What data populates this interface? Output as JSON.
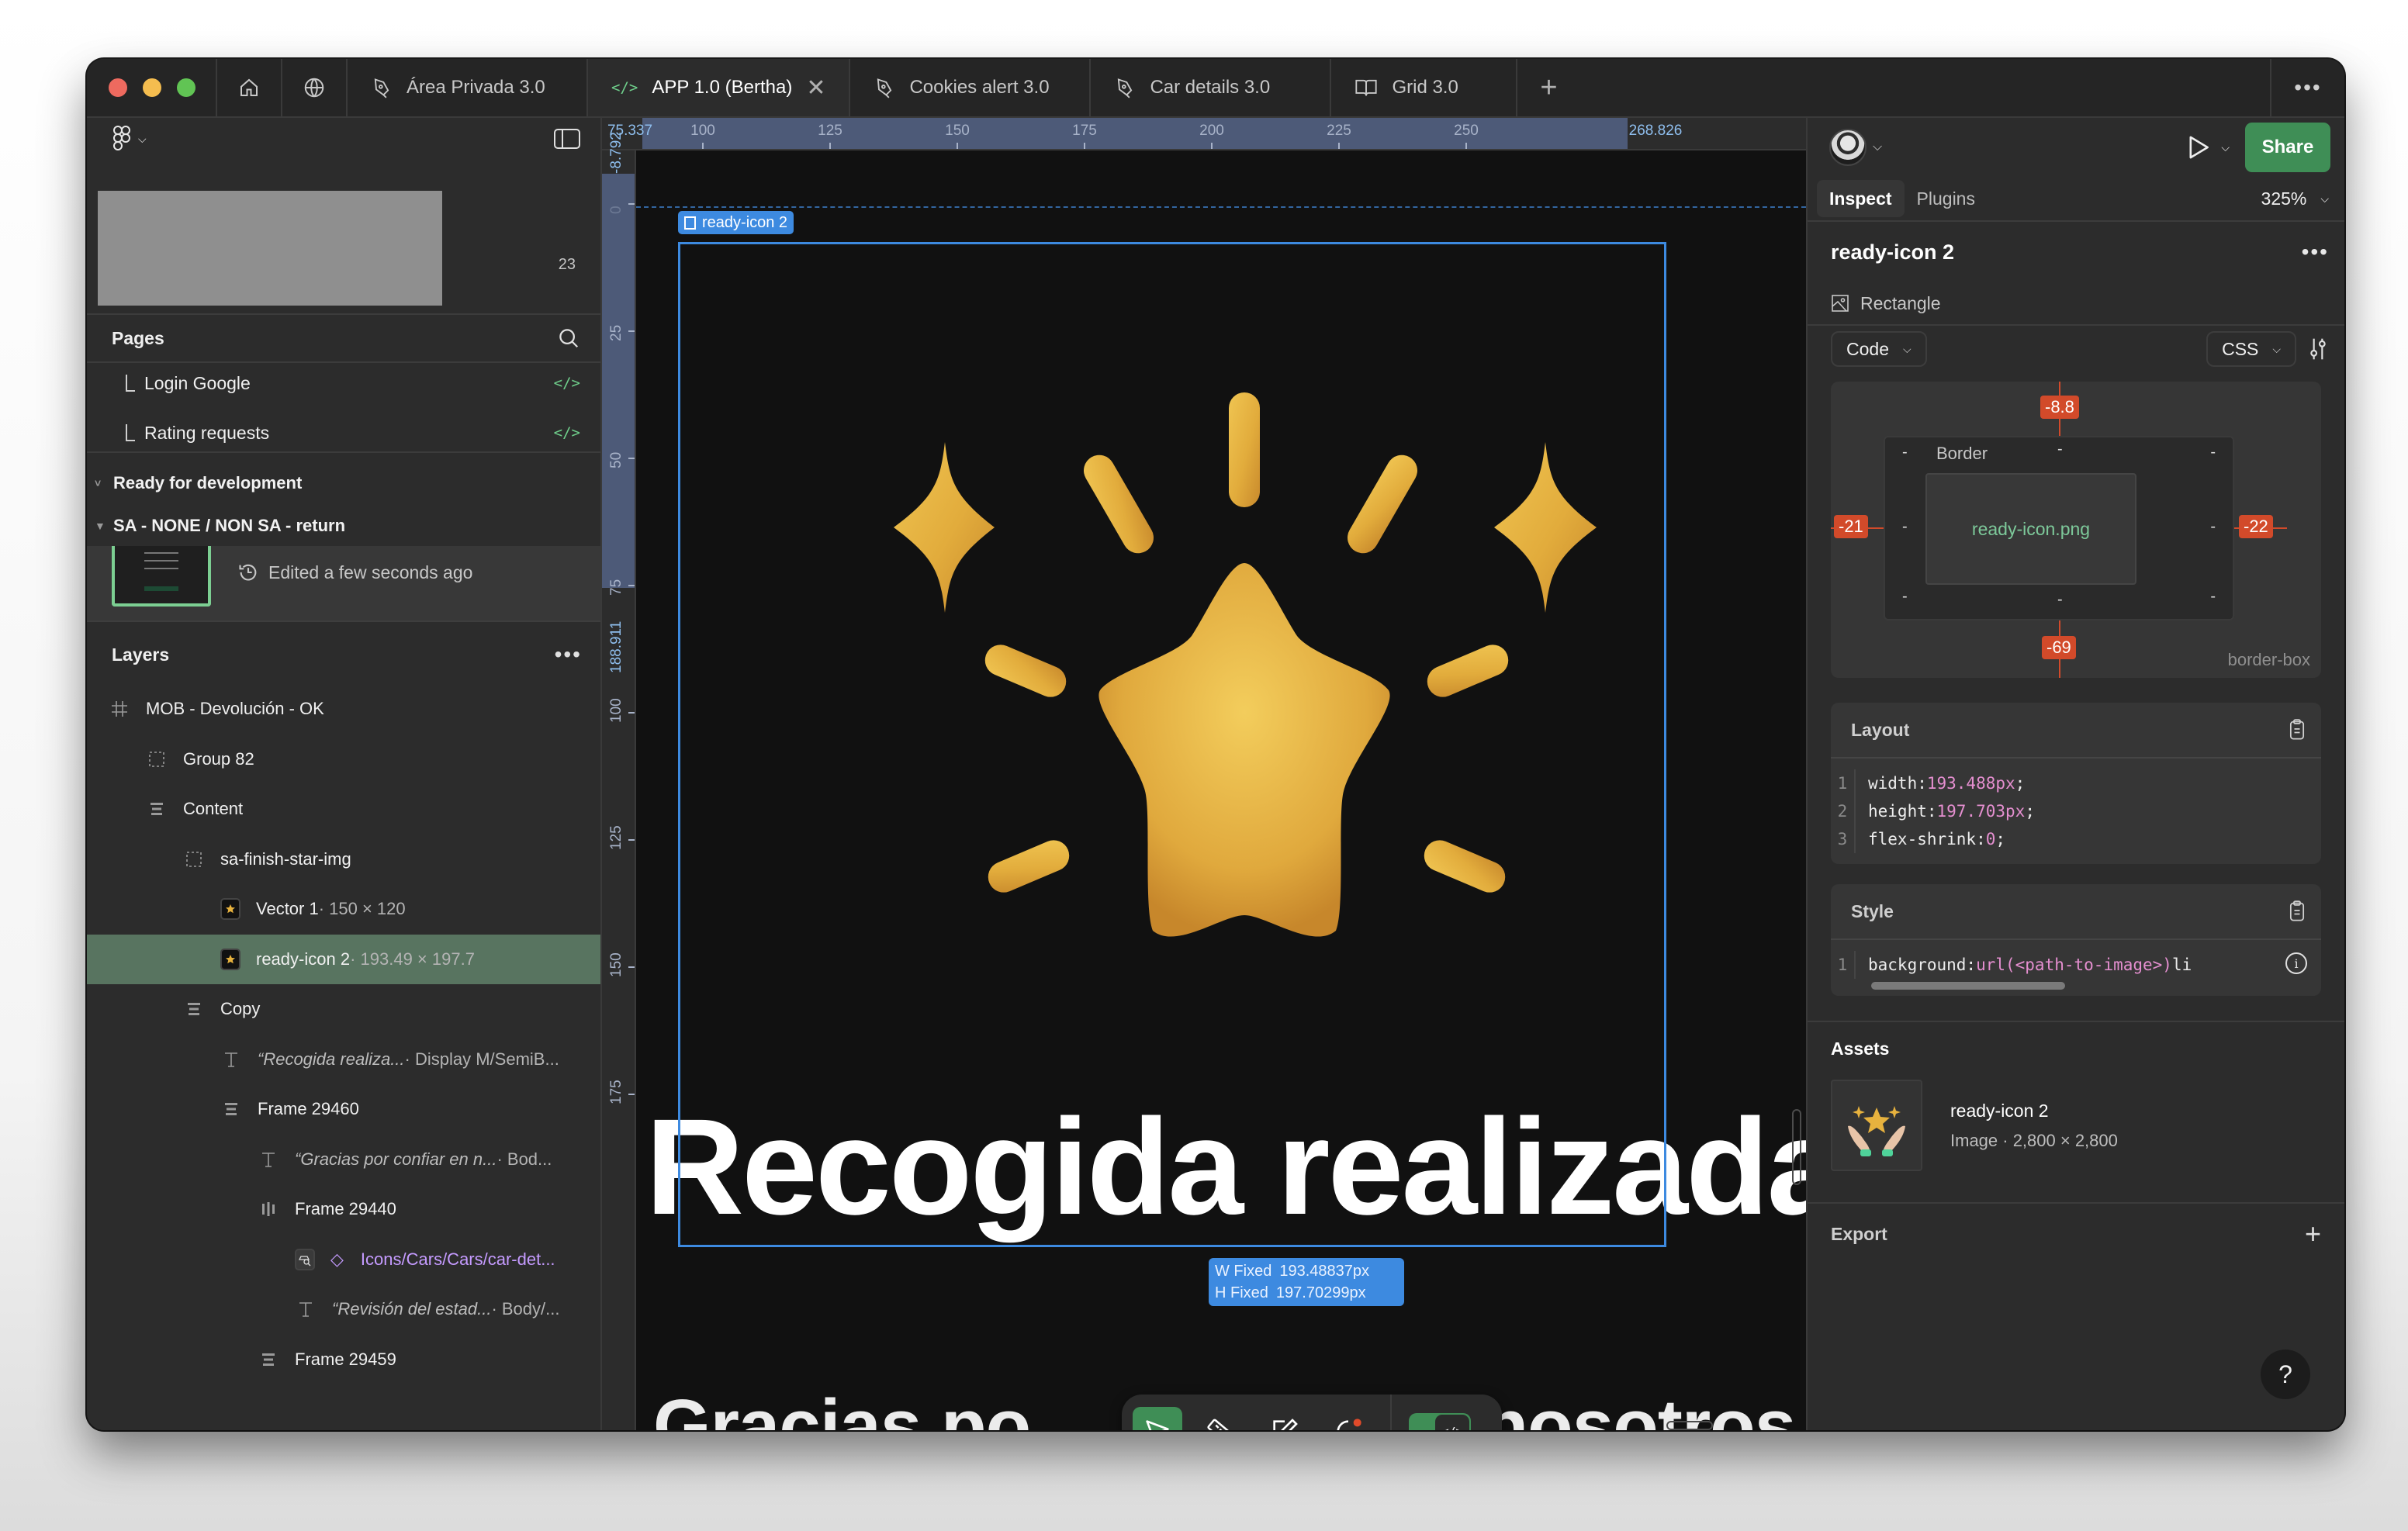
{
  "tabs": [
    {
      "label": "Área Privada 3.0",
      "icon": "pen-tool-icon",
      "active": false
    },
    {
      "label": "APP 1.0 (Bertha)",
      "icon": "code-icon",
      "active": true,
      "closable": true
    },
    {
      "label": "Cookies alert 3.0",
      "icon": "pen-tool-icon",
      "active": false
    },
    {
      "label": "Car details 3.0",
      "icon": "pen-tool-icon",
      "active": false
    },
    {
      "label": "Grid 3.0",
      "icon": "book-icon",
      "active": false
    }
  ],
  "tab_bar": {
    "close_glyph": "✕",
    "add_glyph": "+",
    "more_glyph": "•••"
  },
  "sidebar": {
    "thumbnail_count": "23",
    "pages_title": "Pages",
    "pages": [
      {
        "label": "Login Google",
        "badge": "</>"
      },
      {
        "label": "Rating requests",
        "badge": "</>"
      }
    ],
    "sections": [
      {
        "label": "Ready for development",
        "caret": "˅"
      },
      {
        "label": "SA - NONE / NON SA - return",
        "caret": "▼"
      }
    ],
    "frame_card": {
      "edited": "Edited a few seconds ago"
    },
    "layers_title": "Layers",
    "layers": [
      {
        "name": "MOB - Devolución - OK",
        "meta": "",
        "icon": "frame-hash-icon",
        "indent": 0
      },
      {
        "name": "Group 82",
        "meta": "",
        "icon": "group-dashed-icon",
        "indent": 1
      },
      {
        "name": "Content",
        "meta": "",
        "icon": "vertical-autolayout-icon",
        "indent": 1
      },
      {
        "name": "sa-finish-star-img",
        "meta": "",
        "icon": "group-dashed-icon",
        "indent": 2
      },
      {
        "name": "Vector 1",
        "meta": " · 150 × 120",
        "icon": "image-thumb-icon",
        "indent": 3
      },
      {
        "name": "ready-icon 2",
        "meta": " · 193.49 × 197.7",
        "icon": "image-thumb-icon",
        "indent": 3,
        "selected": true
      },
      {
        "name": "Copy",
        "meta": "",
        "icon": "vertical-autolayout-icon",
        "indent": 2
      },
      {
        "name": "“Recogida realiza...",
        "meta": " · Display M/SemiB...",
        "icon": "text-icon",
        "indent": 3,
        "italic": true
      },
      {
        "name": "Frame 29460",
        "meta": "",
        "icon": "vertical-autolayout-icon",
        "indent": 3
      },
      {
        "name": "“Gracias por confiar en n...",
        "meta": " · Bod...",
        "icon": "text-icon",
        "indent": 4,
        "italic": true
      },
      {
        "name": "Frame 29440",
        "meta": "",
        "icon": "horizontal-autolayout-icon",
        "indent": 4
      },
      {
        "name": "Icons/Cars/Cars/car-det...",
        "meta": "",
        "icon": "component-instance-icon",
        "indent": 5,
        "purple": true
      },
      {
        "name": "“Revisión del estad...",
        "meta": " · Body/...",
        "icon": "text-icon",
        "indent": 5,
        "italic": true
      },
      {
        "name": "Frame 29459",
        "meta": "",
        "icon": "vertical-autolayout-icon",
        "indent": 4
      }
    ]
  },
  "rulers": {
    "top_start": "75.337",
    "top_end": "268.826",
    "top_ticks": [
      "100",
      "125",
      "150",
      "175",
      "200",
      "225",
      "250"
    ],
    "left_start": "-8.792",
    "left_end": "188.911",
    "left_ticks": [
      "0",
      "25",
      "50",
      "75",
      "100",
      "125",
      "150",
      "175"
    ]
  },
  "canvas": {
    "selection_label": "ready-icon 2",
    "headline": "Recogida realizada",
    "subline_left": "Gracias po",
    "subline_right": "n nosotros.",
    "dim_w_label": "W Fixed",
    "dim_w_value": "193.48837px",
    "dim_h_label": "H Fixed",
    "dim_h_value": "197.70299px"
  },
  "toolbar": {
    "tools": [
      "move-tool",
      "measure-tool",
      "annotate-tool",
      "comment-tool"
    ],
    "dev_mode_on": true
  },
  "right_panel": {
    "tabs": [
      {
        "label": "Inspect",
        "active": true
      },
      {
        "label": "Plugins",
        "active": false
      }
    ],
    "zoom": "325%",
    "share_label": "Share",
    "node_name": "ready-icon 2",
    "node_type": "Rectangle",
    "code_dropdown": "Code",
    "lang_dropdown": "CSS",
    "box_model": {
      "margin_top": "-8.8",
      "margin_left": "-21",
      "margin_right": "-22",
      "margin_bottom": "-69",
      "border_label": "Border",
      "content_label": "ready-icon.png",
      "placeholder": "-",
      "sizing": "border-box"
    },
    "layout": {
      "title": "Layout",
      "lines": [
        {
          "n": "1",
          "prop": "width: ",
          "val": "193.488px",
          "end": ";"
        },
        {
          "n": "2",
          "prop": "height: ",
          "val": "197.703px",
          "end": ";"
        },
        {
          "n": "3",
          "prop": "flex-shrink: ",
          "val": "0",
          "end": ";"
        }
      ]
    },
    "style": {
      "title": "Style",
      "lines": [
        {
          "n": "1",
          "prop": "background: ",
          "val": "url(<path-to-image>)",
          "end": " li"
        }
      ]
    },
    "assets": {
      "title": "Assets",
      "items": [
        {
          "name": "ready-icon 2",
          "meta": "Image · 2,800 × 2,800"
        }
      ]
    },
    "export_title": "Export",
    "help_glyph": "?"
  },
  "colors": {
    "accent_blue": "#3d8ae0",
    "brand_green": "#3f8e56",
    "selected_row": "#587460",
    "code_value_pink": "#e58fd0",
    "margin_red": "#d24a2a",
    "star_gold": "#e7b23e"
  }
}
